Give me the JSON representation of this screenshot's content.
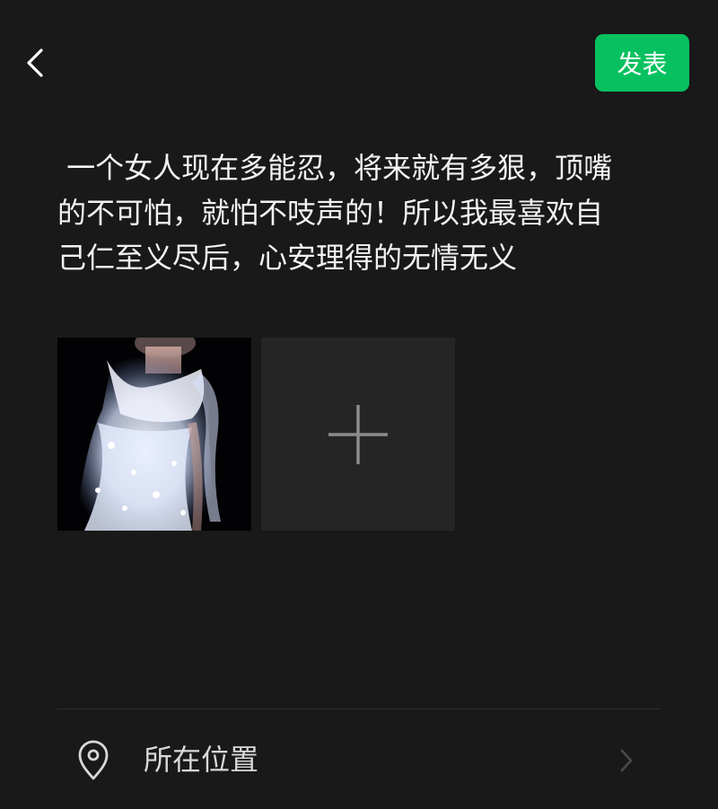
{
  "header": {
    "publish_label": "发表"
  },
  "post": {
    "text": " 一个女人现在多能忍，将来就有多狠，顶嘴\n的不可怕，就怕不吱声的！所以我最喜欢自\n己仁至义尽后，心安理得的无情无义"
  },
  "icons": {
    "back": "chevron-left-icon",
    "add": "plus-icon",
    "location": "location-pin-icon",
    "arrow": "chevron-right-icon"
  },
  "location": {
    "label": "所在位置"
  },
  "colors": {
    "background": "#191919",
    "accent": "#07c160",
    "add_tile": "#252525"
  }
}
